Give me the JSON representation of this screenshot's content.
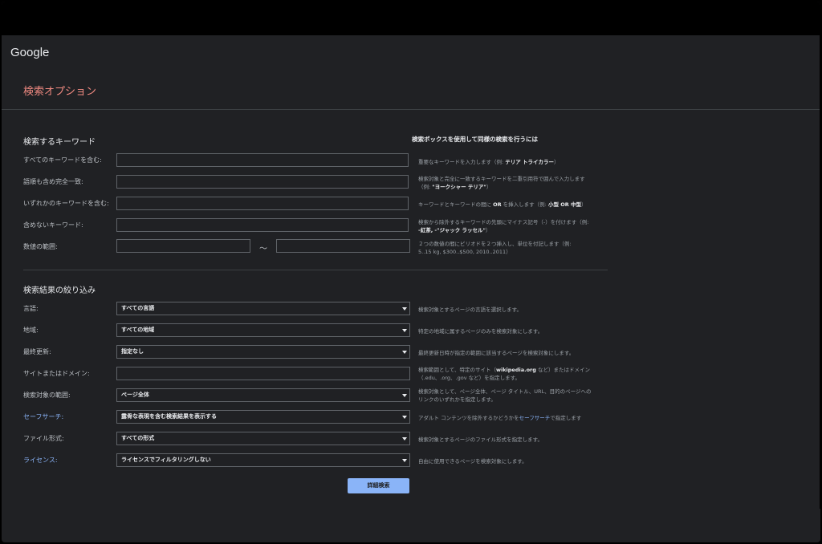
{
  "logo": "Google",
  "page_title": "検索オプション",
  "keywords_section": {
    "heading": "検索するキーワード",
    "help_heading": "検索ボックスを使用して同様の検索を行うには",
    "rows": [
      {
        "label": "すべてのキーワードを含む:",
        "help_pre": "重要なキーワードを入力します（例: ",
        "help_bold": "テリア トライカラー",
        "help_post": "）",
        "help_line2": ""
      },
      {
        "label": "語順も含め完全一致:",
        "help_pre": "検索対象と完全に一致するキーワードを二重引用符で囲んで入力します",
        "help_bold": "",
        "help_post": "",
        "help_line2_pre": "（例: ",
        "help_line2_bold": "\"ヨークシャー テリア\"",
        "help_line2_post": "）"
      },
      {
        "label": "いずれかのキーワードを含む:",
        "help_pre": "キーワードとキーワードの間に ",
        "help_bold": "OR",
        "help_post": " を挿入します（例: ",
        "help_bold2": "小型 OR 中型",
        "help_post2": "）"
      },
      {
        "label": "含めないキーワード:",
        "help_pre": "検索から除外するキーワードの先頭にマイナス記号（-）を付けます（例:",
        "help_line2_bold": "-紅茶, -\"ジャック ラッセル\"",
        "help_line2_post": "）"
      },
      {
        "label": "数値の範囲:",
        "tilde": "〜",
        "help_pre": "２つの数値の間にピリオドを２つ挿入し、単位を付記します（例:",
        "help_line2_post": "5..15 kg, $300..$500, 2010..2011）"
      }
    ]
  },
  "filter_section": {
    "heading": "検索結果の絞り込み",
    "rows": [
      {
        "label": "言語:",
        "link": false,
        "value": "すべての言語",
        "help": "検索対象とするページの言語を選択します。"
      },
      {
        "label": "地域:",
        "link": false,
        "value": "すべての地域",
        "help": "特定の地域に属するページのみを検索対象にします。"
      },
      {
        "label": "最終更新:",
        "link": false,
        "value": "指定なし",
        "help": "最終更新日時が指定の範囲に該当するページを検索対象にします。"
      },
      {
        "label": "サイトまたはドメイン:",
        "link": false,
        "value": "",
        "help": "検索範囲として、特定のサイト（",
        "help_bold": "wikipedia.org",
        "help_post": " など）またはドメイン",
        "help_line2": "（.edu、.org、.gov など）を指定します。"
      },
      {
        "label": "検索対象の範囲:",
        "link": false,
        "value": "ページ全体",
        "help": "検索対象として、ページ全体、ページ タイトル、URL、目的のページへの",
        "help_line2": "リンクのいずれかを指定します。"
      },
      {
        "label": "セーフサーチ:",
        "link": true,
        "value": "露骨な表現を含む検索結果を表示する",
        "help": "アダルト コンテンツを除外するかどうかを",
        "help_link": "セーフサーチ",
        "help_post": "で指定します"
      },
      {
        "label": "ファイル形式:",
        "link": false,
        "value": "すべての形式",
        "help": "検索対象とするページのファイル形式を指定します。"
      },
      {
        "label": "ライセンス:",
        "link": true,
        "value": "ライセンスでフィルタリングしない",
        "help": "自由に使用できるページを検索対象にします。"
      }
    ]
  },
  "submit_label": "詳細検索"
}
